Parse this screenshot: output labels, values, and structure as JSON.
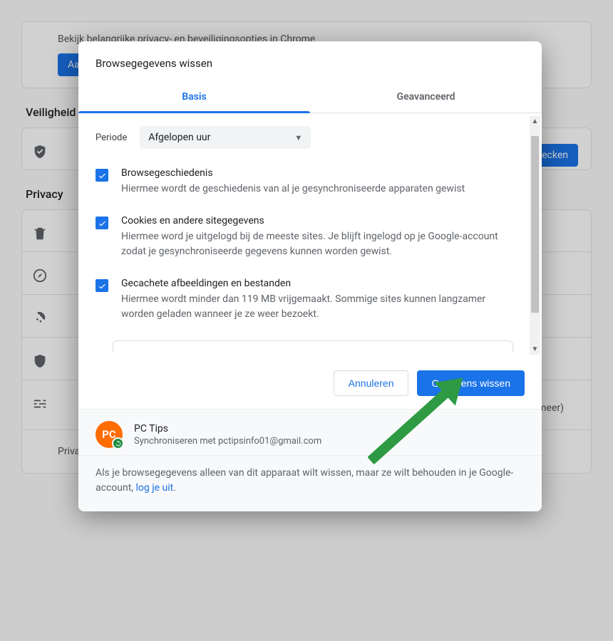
{
  "bg": {
    "top_desc": "Bekijk belangrijke privacy- en beveiligingsopties in Chrome",
    "top_btn": "Aa",
    "section1": "Veiligheid",
    "nu_btn": "Nu checken",
    "section2": "Privacy",
    "more": "meer)",
    "last_row": "Privacy Sandbox"
  },
  "dialog": {
    "title": "Browsegegevens wissen",
    "tabs": {
      "basic": "Basis",
      "advanced": "Geavanceerd"
    },
    "periode_label": "Periode",
    "periode_value": "Afgelopen uur",
    "opts": [
      {
        "title": "Browsegeschiedenis",
        "desc": "Hiermee wordt de geschiedenis van al je gesynchroniseerde apparaten gewist"
      },
      {
        "title": "Cookies en andere sitegegevens",
        "desc": "Hiermee word je uitgelogd bij de meeste sites. Je blijft ingelogd op je Google-account zodat je gesynchroniseerde gegevens kunnen worden gewist."
      },
      {
        "title": "Gecachete afbeeldingen en bestanden",
        "desc": "Hiermee wordt minder dan 119 MB vrijgemaakt. Sommige sites kunnen langzamer worden geladen wanneer je ze weer bezoekt."
      }
    ],
    "cancel": "Annuleren",
    "confirm": "Gegevens wissen",
    "account_initials": "PC",
    "account_name": "PC Tips",
    "account_sync": "Synchroniseren met pctipsinfo01@gmail.com",
    "footnote_a": "Als je browsegegevens alleen van dit apparaat wilt wissen, maar ze wilt behouden in je Google-account, ",
    "footnote_link": "log je uit",
    "footnote_b": "."
  }
}
